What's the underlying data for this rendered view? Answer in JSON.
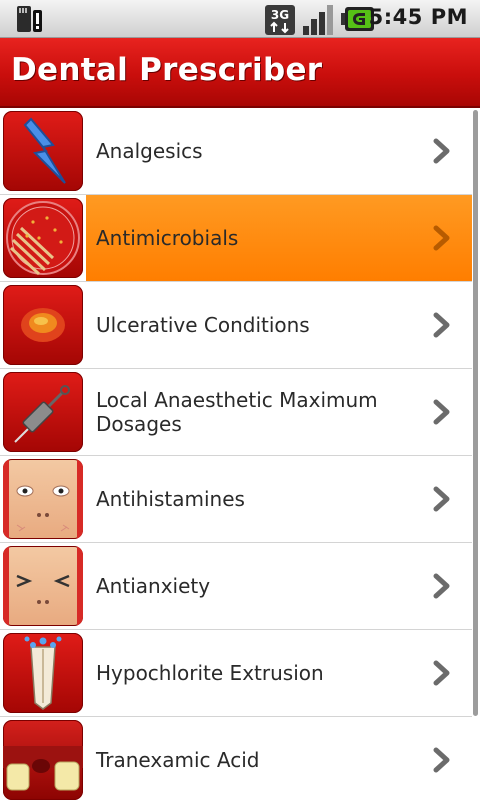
{
  "status_bar": {
    "network": "3G",
    "time": "5:45 PM"
  },
  "app": {
    "title": "Dental Prescriber"
  },
  "list": {
    "items": [
      {
        "label": "Analgesics",
        "icon": "lightning-icon"
      },
      {
        "label": "Antimicrobials",
        "icon": "petri-dish-icon",
        "selected": true
      },
      {
        "label": "Ulcerative Conditions",
        "icon": "ulcer-icon"
      },
      {
        "label": "Local Anaesthetic Maximum Dosages",
        "icon": "syringe-icon"
      },
      {
        "label": "Antihistamines",
        "icon": "swollen-face-icon"
      },
      {
        "label": "Antianxiety",
        "icon": "anxious-face-icon"
      },
      {
        "label": "Hypochlorite Extrusion",
        "icon": "tooth-root-icon"
      },
      {
        "label": "Tranexamic Acid",
        "icon": "teeth-gum-icon"
      }
    ]
  },
  "colors": {
    "title_bar": "#c90e0c",
    "selection": "#ff8a0f",
    "chevron": "#6b6b6b"
  }
}
